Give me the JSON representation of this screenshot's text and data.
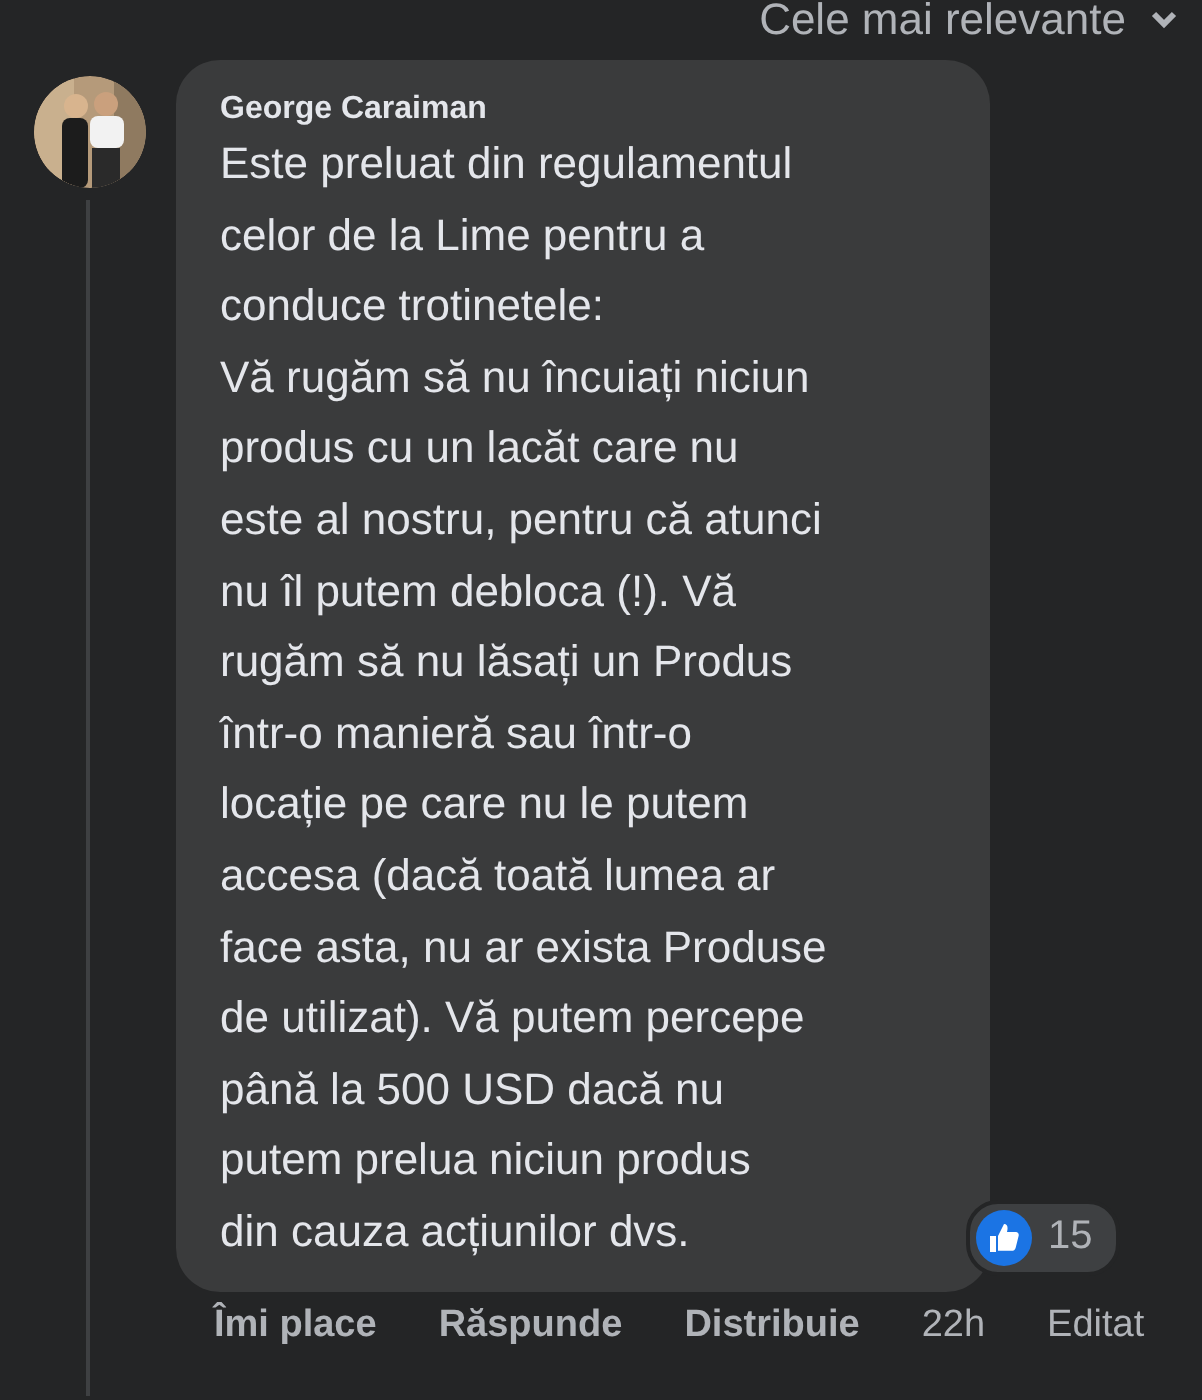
{
  "sort_menu": {
    "label": "Cele mai relevante"
  },
  "comment": {
    "author": "George Caraiman",
    "text": "Este preluat din regulamentul\ncelor de la Lime pentru a\nconduce trotinetele:\nVă rugăm să nu încuiați niciun\nprodus cu un lacăt care nu\neste al nostru, pentru că atunci\nnu îl putem debloca (!). Vă\nrugăm să nu lăsați un Produs\nîntr-o manieră sau într-o\nlocație pe care nu le putem\naccesa (dacă toată lumea ar\nface asta, nu ar exista Produse\nde utilizat). Vă putem percepe\npână la 500 USD dacă nu\nputem prelua niciun produs\ndin cauza acțiunilor dvs.",
    "reaction_count": "15",
    "actions": [
      "Îmi place",
      "Răspunde",
      "Distribuie"
    ],
    "time": "22h",
    "edited_label": "Editat"
  }
}
